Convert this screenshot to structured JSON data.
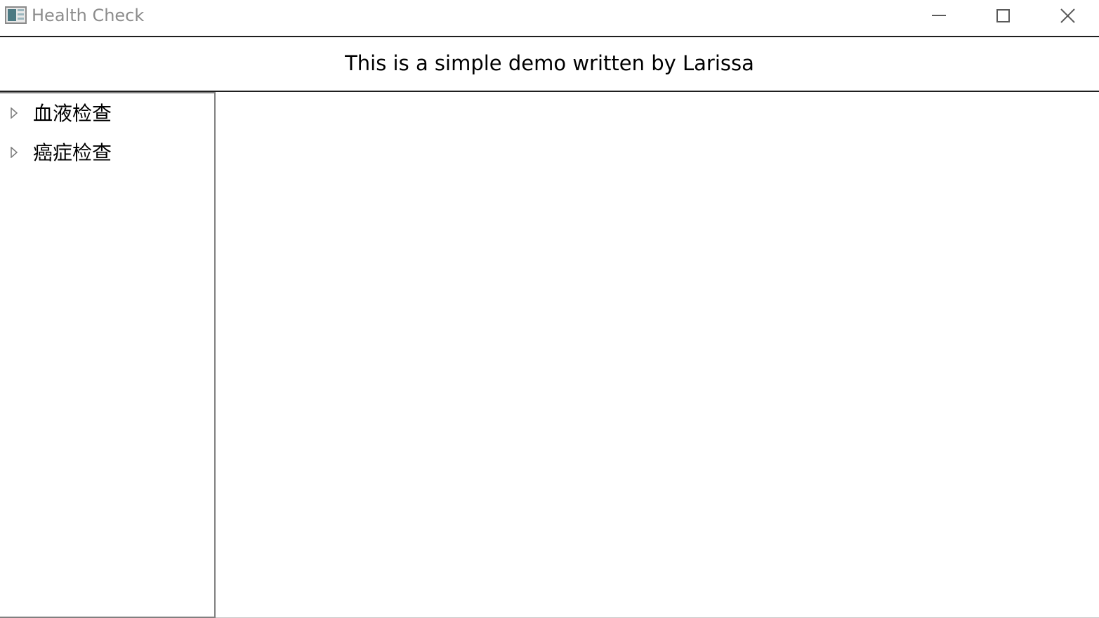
{
  "window": {
    "title": "Health Check",
    "icon": "app-window-icon",
    "controls": {
      "minimize_icon": "minimize-icon",
      "maximize_icon": "maximize-icon",
      "close_icon": "close-icon"
    }
  },
  "header": {
    "text": "This is a simple demo written by Larissa"
  },
  "sidebar": {
    "items": [
      {
        "label": "血液检查",
        "expanded": false,
        "icon": "expand-arrow-icon"
      },
      {
        "label": "癌症检查",
        "expanded": false,
        "icon": "expand-arrow-icon"
      }
    ]
  },
  "colors": {
    "title_text": "#8c8c8c",
    "divider": "#1f1f1f",
    "sidebar_border": "#808080"
  }
}
